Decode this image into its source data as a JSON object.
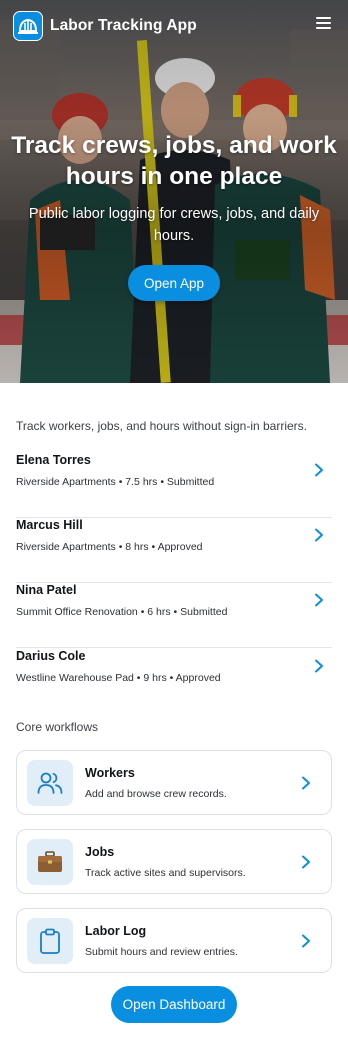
{
  "app": {
    "title": "Labor Tracking App"
  },
  "hero": {
    "title": "Track crews, jobs, and work hours in one place",
    "subtitle": "Public labor logging for crews, jobs, and daily hours.",
    "cta_label": "Open App"
  },
  "intro": "Track workers, jobs, and hours without sign-in barriers.",
  "entries": [
    {
      "name": "Elena Torres",
      "meta": "Riverside Apartments • 7.5 hrs • Submitted"
    },
    {
      "name": "Marcus Hill",
      "meta": "Riverside Apartments • 8 hrs • Approved"
    },
    {
      "name": "Nina Patel",
      "meta": "Summit Office Renovation • 6 hrs • Submitted"
    },
    {
      "name": "Darius Cole",
      "meta": "Westline Warehouse Pad • 9 hrs • Approved"
    }
  ],
  "workflows": {
    "title": "Core workflows",
    "items": [
      {
        "title": "Workers",
        "desc": "Add and browse crew records.",
        "icon": "people-icon"
      },
      {
        "title": "Jobs",
        "desc": "Track active sites and supervisors.",
        "icon": "briefcase-icon"
      },
      {
        "title": "Labor Log",
        "desc": "Submit hours and review entries.",
        "icon": "clipboard-icon"
      }
    ]
  },
  "dashboard_label": "Open Dashboard",
  "colors": {
    "accent": "#0a8fe0",
    "icon_bg": "#e1eef8"
  }
}
